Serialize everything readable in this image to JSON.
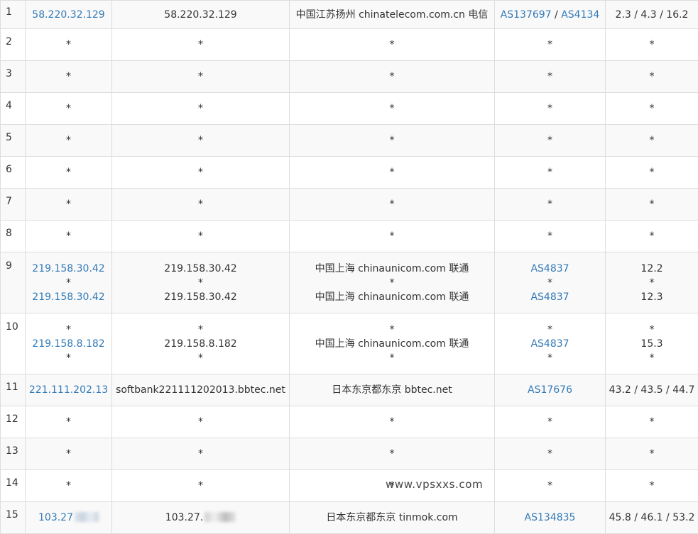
{
  "rows": [
    {
      "hop": "1",
      "ip": "58.220.32.129",
      "host": "58.220.32.129",
      "loc": "中国江苏扬州 chinatelecom.com.cn 电信",
      "asn1": "AS137697",
      "asn2": "AS4134",
      "lat": "2.3 / 4.3 / 16.2"
    },
    {
      "hop": "2"
    },
    {
      "hop": "3"
    },
    {
      "hop": "4"
    },
    {
      "hop": "5"
    },
    {
      "hop": "6"
    },
    {
      "hop": "7"
    },
    {
      "hop": "8"
    },
    {
      "hop": "9",
      "ips": [
        "219.158.30.42",
        "*",
        "219.158.30.42"
      ],
      "hosts": [
        "219.158.30.42",
        "*",
        "219.158.30.42"
      ],
      "locs": [
        "中国上海 chinaunicom.com 联通",
        "*",
        "中国上海 chinaunicom.com 联通"
      ],
      "asns": [
        "AS4837",
        "*",
        "AS4837"
      ],
      "lats": [
        "12.2",
        "*",
        "12.3"
      ]
    },
    {
      "hop": "10",
      "ips": [
        "*",
        "219.158.8.182",
        "*"
      ],
      "hosts": [
        "*",
        "219.158.8.182",
        "*"
      ],
      "locs": [
        "*",
        "中国上海 chinaunicom.com 联通",
        "*"
      ],
      "asns": [
        "*",
        "AS4837",
        "*"
      ],
      "lats": [
        "*",
        "15.3",
        "*"
      ]
    },
    {
      "hop": "11",
      "ip": "221.111.202.13",
      "host": "softbank221111202013.bbtec.net",
      "loc": "日本东京都东京 bbtec.net",
      "asn": "AS17676",
      "lat": "43.2 / 43.5 / 44.7"
    },
    {
      "hop": "12"
    },
    {
      "hop": "13"
    },
    {
      "hop": "14",
      "watermark": "www.vpsxxs.com"
    },
    {
      "hop": "15",
      "ip": "103.27",
      "host": "103.27.",
      "loc": "日本东京都东京 tinmok.com",
      "asn": "AS134835",
      "lat": "45.8 / 46.1 / 53.2"
    }
  ],
  "star": "*",
  "sep": " / ",
  "colors": {
    "link": "#337ab7",
    "stripe": "#f9f9f9",
    "border": "#dddddd",
    "text": "#333333"
  }
}
